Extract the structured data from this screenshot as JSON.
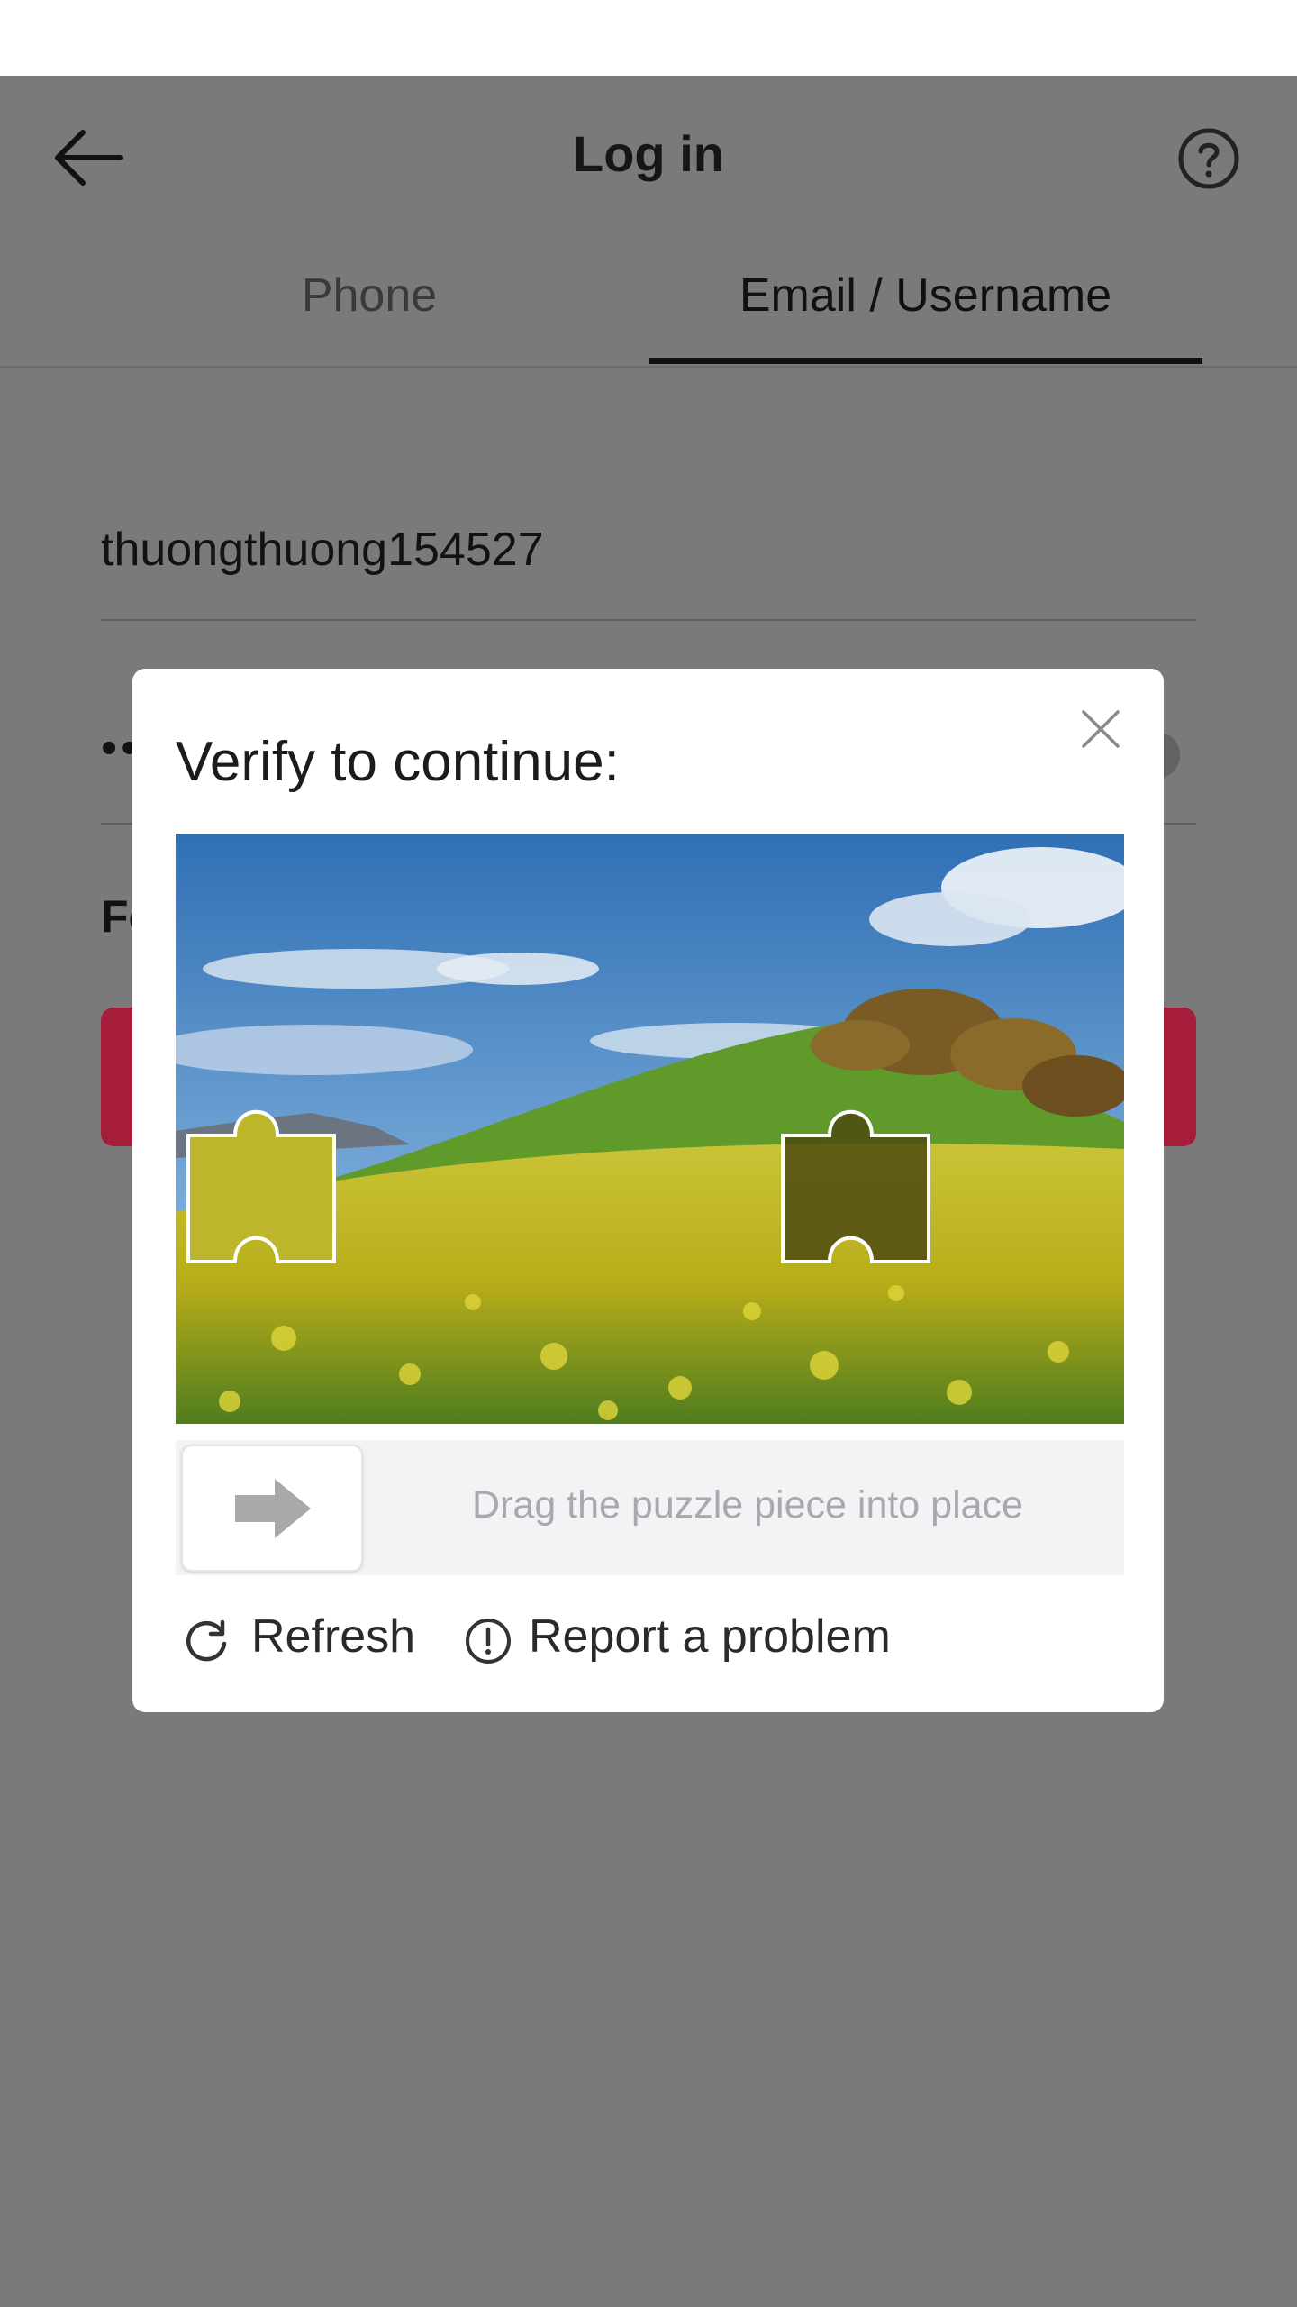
{
  "header": {
    "title": "Log in"
  },
  "tabs": [
    {
      "label": "Phone",
      "selected": false
    },
    {
      "label": "Email / Username",
      "selected": true
    }
  ],
  "form": {
    "username_value": "thuongthuong154527",
    "password_value": "••",
    "forgot_partial": "Fo"
  },
  "captcha": {
    "title": "Verify to continue:",
    "slider_hint": "Drag the puzzle piece into place",
    "refresh_label": "Refresh",
    "report_label": "Report a problem"
  },
  "colors": {
    "overlay": "#7a7a7a",
    "login_button": "#a51d39",
    "slider_track": "#f2f3f5"
  },
  "icons": [
    "back-arrow-icon",
    "help-circle-icon",
    "close-icon",
    "arrow-right-icon",
    "refresh-icon",
    "alert-circle-icon"
  ]
}
